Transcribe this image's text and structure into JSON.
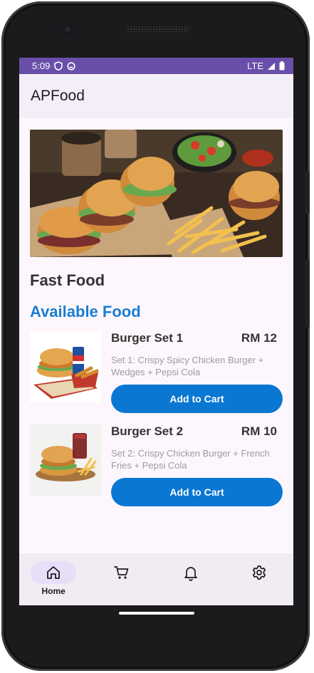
{
  "status_bar": {
    "time": "5:09",
    "network": "LTE"
  },
  "app_bar": {
    "title": "APFood"
  },
  "category": {
    "title": "Fast Food"
  },
  "section": {
    "title": "Available Food"
  },
  "foods": [
    {
      "name": "Burger Set 1",
      "price": "RM 12",
      "description": "Set 1: Crispy Spicy Chicken Burger + Wedges + Pepsi Cola",
      "button_label": "Add to Cart"
    },
    {
      "name": "Burger Set 2",
      "price": "RM 10",
      "description": "Set 2: Crispy Chicken Burger + French Fries + Pepsi Cola",
      "button_label": "Add to Cart"
    }
  ],
  "bottom_nav": {
    "items": [
      {
        "label": "Home",
        "icon": "home-icon",
        "active": true
      },
      {
        "label": "",
        "icon": "cart-icon",
        "active": false
      },
      {
        "label": "",
        "icon": "bell-icon",
        "active": false
      },
      {
        "label": "",
        "icon": "gear-icon",
        "active": false
      }
    ]
  },
  "colors": {
    "status_bar": "#6a4faa",
    "accent": "#1a7dd1",
    "button": "#0a77d2",
    "nav_active_pill": "#e8def8"
  }
}
